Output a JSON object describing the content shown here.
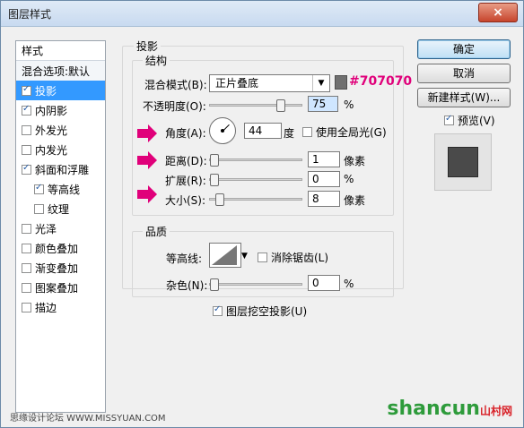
{
  "window": {
    "title": "图层样式",
    "close_symbol": "×"
  },
  "styles_list": {
    "header": "样式",
    "blend_options": "混合选项:默认",
    "items": [
      {
        "label": "投影",
        "checked": true,
        "selected": true
      },
      {
        "label": "内阴影",
        "checked": true
      },
      {
        "label": "外发光",
        "checked": false
      },
      {
        "label": "内发光",
        "checked": false
      },
      {
        "label": "斜面和浮雕",
        "checked": true
      },
      {
        "label": "等高线",
        "checked": true,
        "indent": true
      },
      {
        "label": "纹理",
        "checked": false,
        "indent": true
      },
      {
        "label": "光泽",
        "checked": false
      },
      {
        "label": "颜色叠加",
        "checked": false
      },
      {
        "label": "渐变叠加",
        "checked": false
      },
      {
        "label": "图案叠加",
        "checked": false
      },
      {
        "label": "描边",
        "checked": false
      }
    ]
  },
  "panel": {
    "section_title": "投影",
    "structure": {
      "title": "结构",
      "blend_mode_label": "混合模式(B):",
      "blend_mode_value": "正片叠底",
      "color_hex_annotation": "#707070",
      "color": "#707070",
      "opacity_label": "不透明度(O):",
      "opacity_value": "75",
      "opacity_unit": "%",
      "opacity_fraction": 0.75,
      "angle_label": "角度(A):",
      "angle_value": "44",
      "angle_unit": "度",
      "global_light_label": "使用全局光(G)",
      "distance_label": "距离(D):",
      "distance_value": "1",
      "distance_unit": "像素",
      "spread_label": "扩展(R):",
      "spread_value": "0",
      "spread_unit": "%",
      "size_label": "大小(S):",
      "size_value": "8",
      "size_unit": "像素"
    },
    "quality": {
      "title": "品质",
      "contour_label": "等高线:",
      "anti_alias_label": "消除锯齿(L)",
      "noise_label": "杂色(N):",
      "noise_value": "0",
      "noise_unit": "%"
    },
    "knockout_label": "图层挖空投影(U)"
  },
  "buttons": {
    "ok": "确定",
    "cancel": "取消",
    "new_style": "新建样式(W)...",
    "preview_label": "预览(V)"
  },
  "watermarks": {
    "left": "思缘设计论坛 WWW.MISSYUAN.COM",
    "right": "shancun",
    "right_small": "山村网"
  },
  "colors": {
    "accent_arrow": "#e0007a",
    "selection": "#3399ff"
  }
}
